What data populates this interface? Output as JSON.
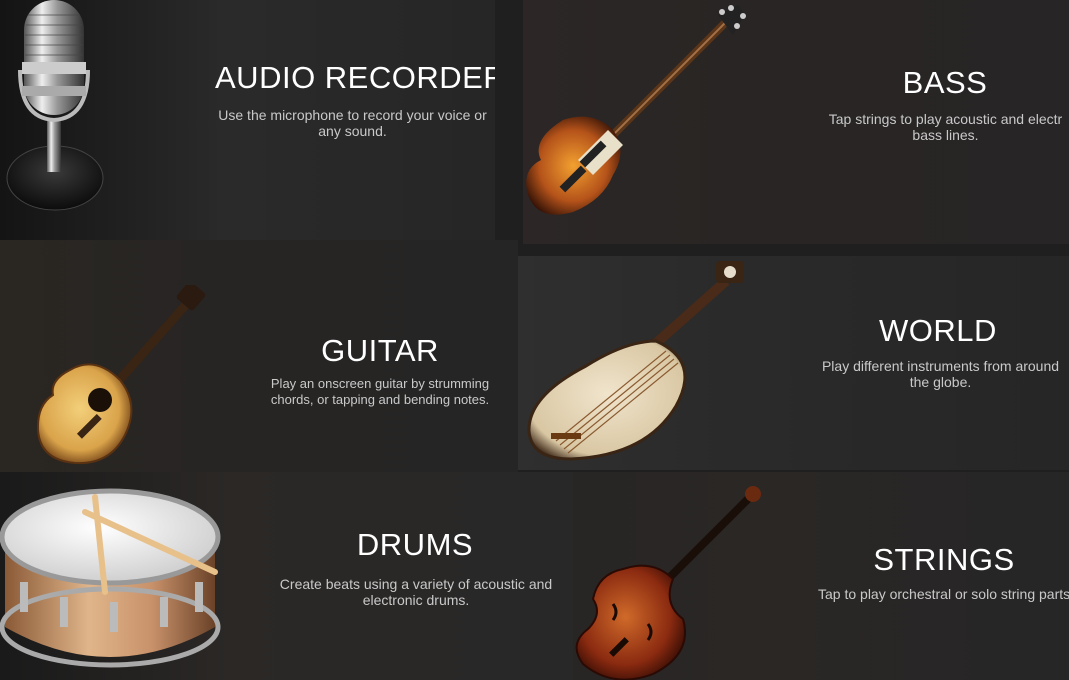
{
  "instruments": {
    "audio_recorder": {
      "title": "AUDIO RECORDER",
      "desc_line1": "Use the microphone to record your voice or",
      "desc_line2": "any sound.",
      "icon": "microphone-icon"
    },
    "bass": {
      "title": "BASS",
      "desc_line1": "Tap strings to play acoustic and electr",
      "desc_line2": "bass lines.",
      "icon": "bass-guitar-icon"
    },
    "guitar": {
      "title": "GUITAR",
      "desc_line1": "Play an onscreen guitar by strumming",
      "desc_line2": "chords, or tapping and bending notes.",
      "icon": "acoustic-guitar-icon"
    },
    "world": {
      "title": "WORLD",
      "desc_line1": "Play different instruments from around",
      "desc_line2": "the globe.",
      "icon": "pipa-icon"
    },
    "drums": {
      "title": "DRUMS",
      "desc_line1": "Create beats using a variety of acoustic and",
      "desc_line2": "electronic drums.",
      "icon": "snare-drum-icon"
    },
    "strings": {
      "title": "STRINGS",
      "desc_line1": "Tap to play orchestral or solo string parts",
      "icon": "violin-icon"
    }
  },
  "colors": {
    "background": "#1f1f1f",
    "title": "#ffffff",
    "description": "#c9c9c9"
  }
}
